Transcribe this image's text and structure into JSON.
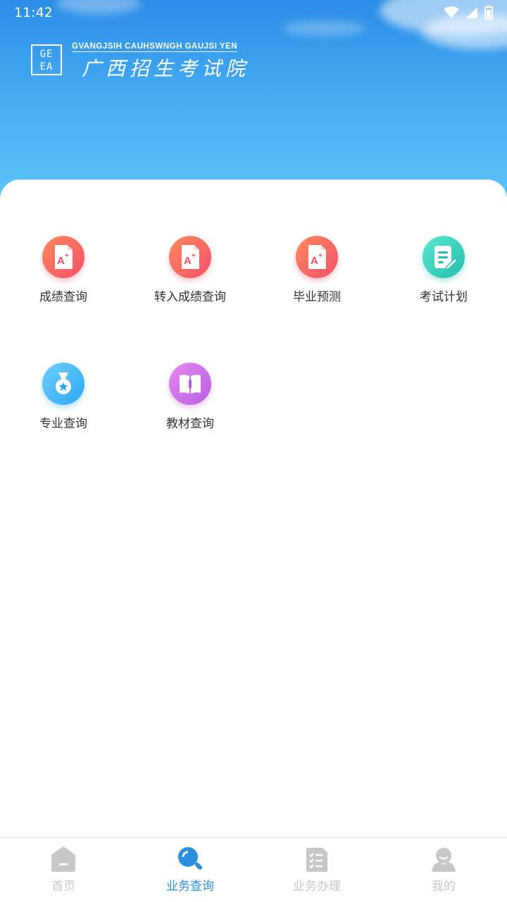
{
  "status_bar": {
    "time": "11:42"
  },
  "header": {
    "logo_mark": "GE\nEA",
    "logo_english": "GVANGJSIH CAUHSWNGH GAUJSI YEN",
    "logo_chinese": "广西招生考试院"
  },
  "services": [
    {
      "label": "成绩查询",
      "icon": "grade-doc-icon",
      "color": "#f2506a"
    },
    {
      "label": "转入成绩查询",
      "icon": "grade-doc-icon",
      "color": "#f2506a"
    },
    {
      "label": "毕业预测",
      "icon": "grade-doc-icon",
      "color": "#f2506a"
    },
    {
      "label": "考试计划",
      "icon": "exam-plan-icon",
      "color": "#22bfae"
    },
    {
      "label": "专业查询",
      "icon": "medal-icon",
      "color": "#2aa7ee"
    },
    {
      "label": "教材查询",
      "icon": "book-icon",
      "color": "#b85ee0"
    }
  ],
  "tabbar": {
    "items": [
      {
        "label": "首页",
        "icon": "home-icon",
        "active": false
      },
      {
        "label": "业务查询",
        "icon": "search-icon",
        "active": true
      },
      {
        "label": "业务办理",
        "icon": "checklist-icon",
        "active": false
      },
      {
        "label": "我的",
        "icon": "profile-icon",
        "active": false
      }
    ],
    "active_color": "#2a8fe0",
    "inactive_color": "#c8c8c8"
  }
}
